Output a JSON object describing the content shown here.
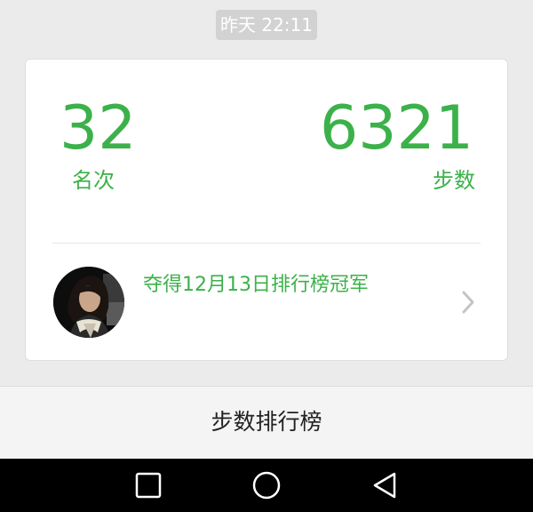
{
  "chat": {
    "timestamp": "昨天 22:11"
  },
  "card": {
    "rank": {
      "value": "32",
      "label": "名次"
    },
    "steps": {
      "value": "6321",
      "label": "步数"
    },
    "champion": {
      "text": "夺得12月13日排行榜冠军"
    }
  },
  "bottom_bar": {
    "label": "步数排行榜"
  },
  "nav": {
    "buttons": [
      "square-icon",
      "circle-icon",
      "back-triangle-icon"
    ]
  },
  "colors": {
    "accent": "#3cb14a",
    "background": "#ebebeb",
    "card": "#ffffff",
    "nav_bar": "#000000"
  }
}
